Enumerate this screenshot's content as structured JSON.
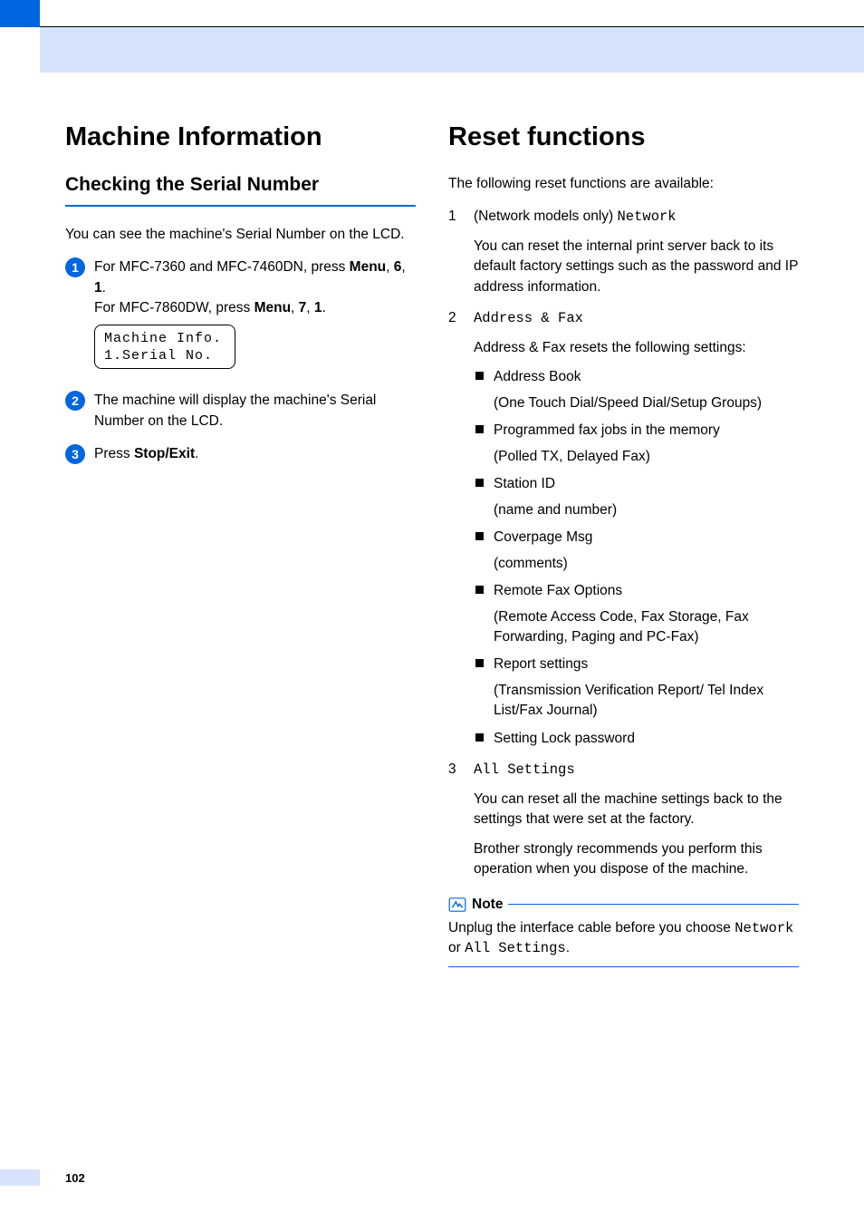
{
  "left": {
    "h1": "Machine Information",
    "h2": "Checking the Serial Number",
    "intro": "You can see the machine's Serial Number on the LCD.",
    "step1_line1": "For MFC-7360 and MFC-7460DN, press ",
    "menu_label": "Menu",
    "sep": ", ",
    "digit6": "6",
    "digit1": "1",
    "period": ".",
    "step1_line2a": "For MFC-7860DW, press ",
    "digit7": "7",
    "lcd_l1": "Machine Info.",
    "lcd_l2": "1.Serial No.",
    "step2": "The machine will display the machine's Serial Number on the LCD.",
    "step3_a": "Press ",
    "stop_exit": "Stop/Exit",
    "step3_b": "."
  },
  "right": {
    "h1": "Reset functions",
    "intro": "The following reset functions are available:",
    "items": [
      {
        "lead_a": "(Network models only) ",
        "lead_mono": "Network",
        "desc": "You can reset the internal print server back to its default factory settings such as the password and IP address information."
      },
      {
        "lead_mono": "Address & Fax",
        "desc": "Address & Fax resets the following settings:",
        "bullets": [
          {
            "t": "Address Book",
            "sub": "(One Touch Dial/Speed Dial/Setup Groups)"
          },
          {
            "t": "Programmed fax jobs in the memory",
            "sub": "(Polled TX, Delayed Fax)"
          },
          {
            "t": "Station ID",
            "sub": "(name and number)"
          },
          {
            "t": "Coverpage Msg",
            "sub": "(comments)"
          },
          {
            "t": "Remote Fax Options",
            "sub": "(Remote Access Code, Fax Storage, Fax Forwarding, Paging and PC-Fax)"
          },
          {
            "t": "Report settings",
            "sub": "(Transmission Verification Report/ Tel Index List/Fax Journal)"
          },
          {
            "t": "Setting Lock password"
          }
        ]
      },
      {
        "lead_mono": "All Settings",
        "desc": "You can reset all the machine settings back to the settings that were set at the factory.",
        "desc2": "Brother strongly recommends you perform this operation when you dispose of the machine."
      }
    ],
    "note_label": "Note",
    "note_a": "Unplug the interface cable before you choose ",
    "note_m1": "Network",
    "note_b": " or ",
    "note_m2": "All Settings",
    "note_c": "."
  },
  "page_number": "102"
}
